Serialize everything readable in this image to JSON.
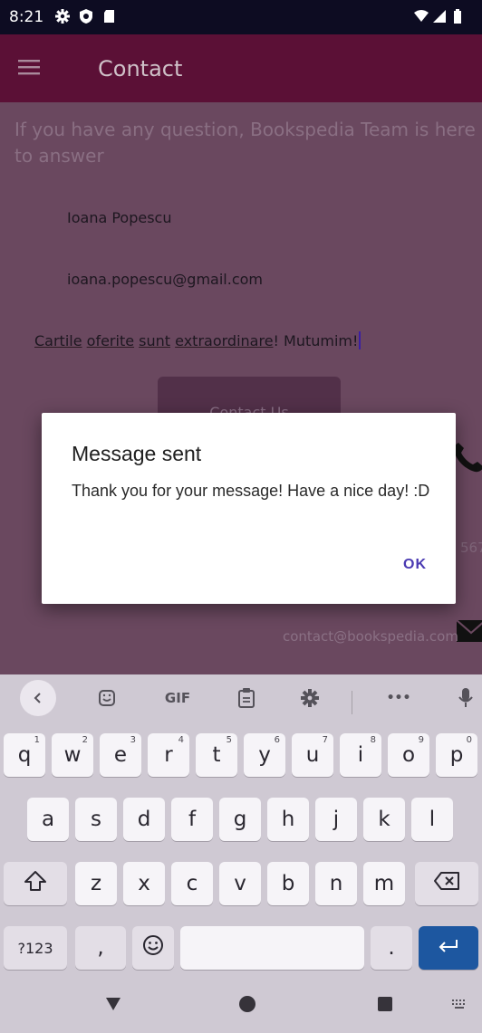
{
  "status_bar": {
    "time": "8:21"
  },
  "app_bar": {
    "title": "Contact"
  },
  "contact": {
    "intro": "If you have any question, Bookspedia Team is here to answer",
    "name": "Ioana Popescu",
    "email": "ioana.popescu@gmail.com",
    "message_words": [
      "Cartile",
      "oferite",
      "sunt",
      "extraordinare"
    ],
    "message_tail": "! Mutumim!",
    "button_label": "Contact Us",
    "phone_partial": "567",
    "email_contact": "contact@bookspedia.com"
  },
  "dialog": {
    "title": "Message sent",
    "body": "Thank you for your message! Have a nice day! :D",
    "ok_label": "OK"
  },
  "keyboard": {
    "toolbar": {
      "gif": "GIF",
      "more": "•••"
    },
    "row1": [
      {
        "k": "q",
        "n": "1"
      },
      {
        "k": "w",
        "n": "2"
      },
      {
        "k": "e",
        "n": "3"
      },
      {
        "k": "r",
        "n": "4"
      },
      {
        "k": "t",
        "n": "5"
      },
      {
        "k": "y",
        "n": "6"
      },
      {
        "k": "u",
        "n": "7"
      },
      {
        "k": "i",
        "n": "8"
      },
      {
        "k": "o",
        "n": "9"
      },
      {
        "k": "p",
        "n": "0"
      }
    ],
    "row2": [
      "a",
      "s",
      "d",
      "f",
      "g",
      "h",
      "j",
      "k",
      "l"
    ],
    "row3": [
      "z",
      "x",
      "c",
      "v",
      "b",
      "n",
      "m"
    ],
    "bottom": {
      "symbols": "?123",
      "comma": ",",
      "period": "."
    }
  },
  "colors": {
    "status_bar": "#0d0c22",
    "app_bar": "#5b1036",
    "dialog_accent": "#4a3ab2",
    "enter_key": "#1d57a0"
  },
  "icons": {
    "menu": "menu-icon",
    "phone": "phone-icon",
    "mail": "mail-icon",
    "sticker": "sticker-icon",
    "clipboard": "clipboard-icon",
    "settings": "gear-icon",
    "mic": "mic-icon",
    "shift": "shift-icon",
    "backspace": "backspace-icon",
    "emoji": "emoji-icon",
    "enter": "enter-icon"
  }
}
